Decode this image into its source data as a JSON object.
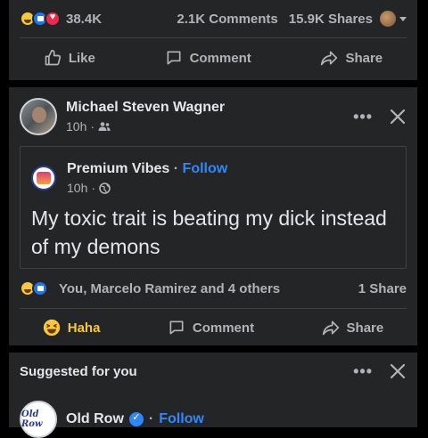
{
  "top_post": {
    "reaction_count": "38.4K",
    "comments_count": "2.1K Comments",
    "shares_count": "15.9K Shares",
    "actions": {
      "like": "Like",
      "comment": "Comment",
      "share": "Share"
    }
  },
  "post": {
    "author": "Michael Steven Wagner",
    "time": "10h",
    "separator": "·",
    "privacy_icon": "friends-icon",
    "shared": {
      "page_name": "Premium Vibes",
      "separator": "·",
      "follow_label": "Follow",
      "time": "10h",
      "privacy_icon": "globe-icon",
      "caption": "My toxic trait is beating my dick instead of my demons"
    },
    "reactions_text": "You, Marcelo Ramirez and 4 others",
    "shares_text": "1 Share",
    "actions": {
      "haha": "Haha",
      "comment": "Comment",
      "share": "Share"
    }
  },
  "suggested": {
    "heading": "Suggested for you",
    "page_name": "Old Row",
    "logo_text": "Old Row",
    "separator": "·",
    "follow_label": "Follow"
  },
  "colors": {
    "background": "#000000",
    "card": "#242526",
    "accent_blue": "#2d88ff",
    "haha_yellow": "#f7c93a",
    "text_secondary": "#b0b3b8"
  }
}
